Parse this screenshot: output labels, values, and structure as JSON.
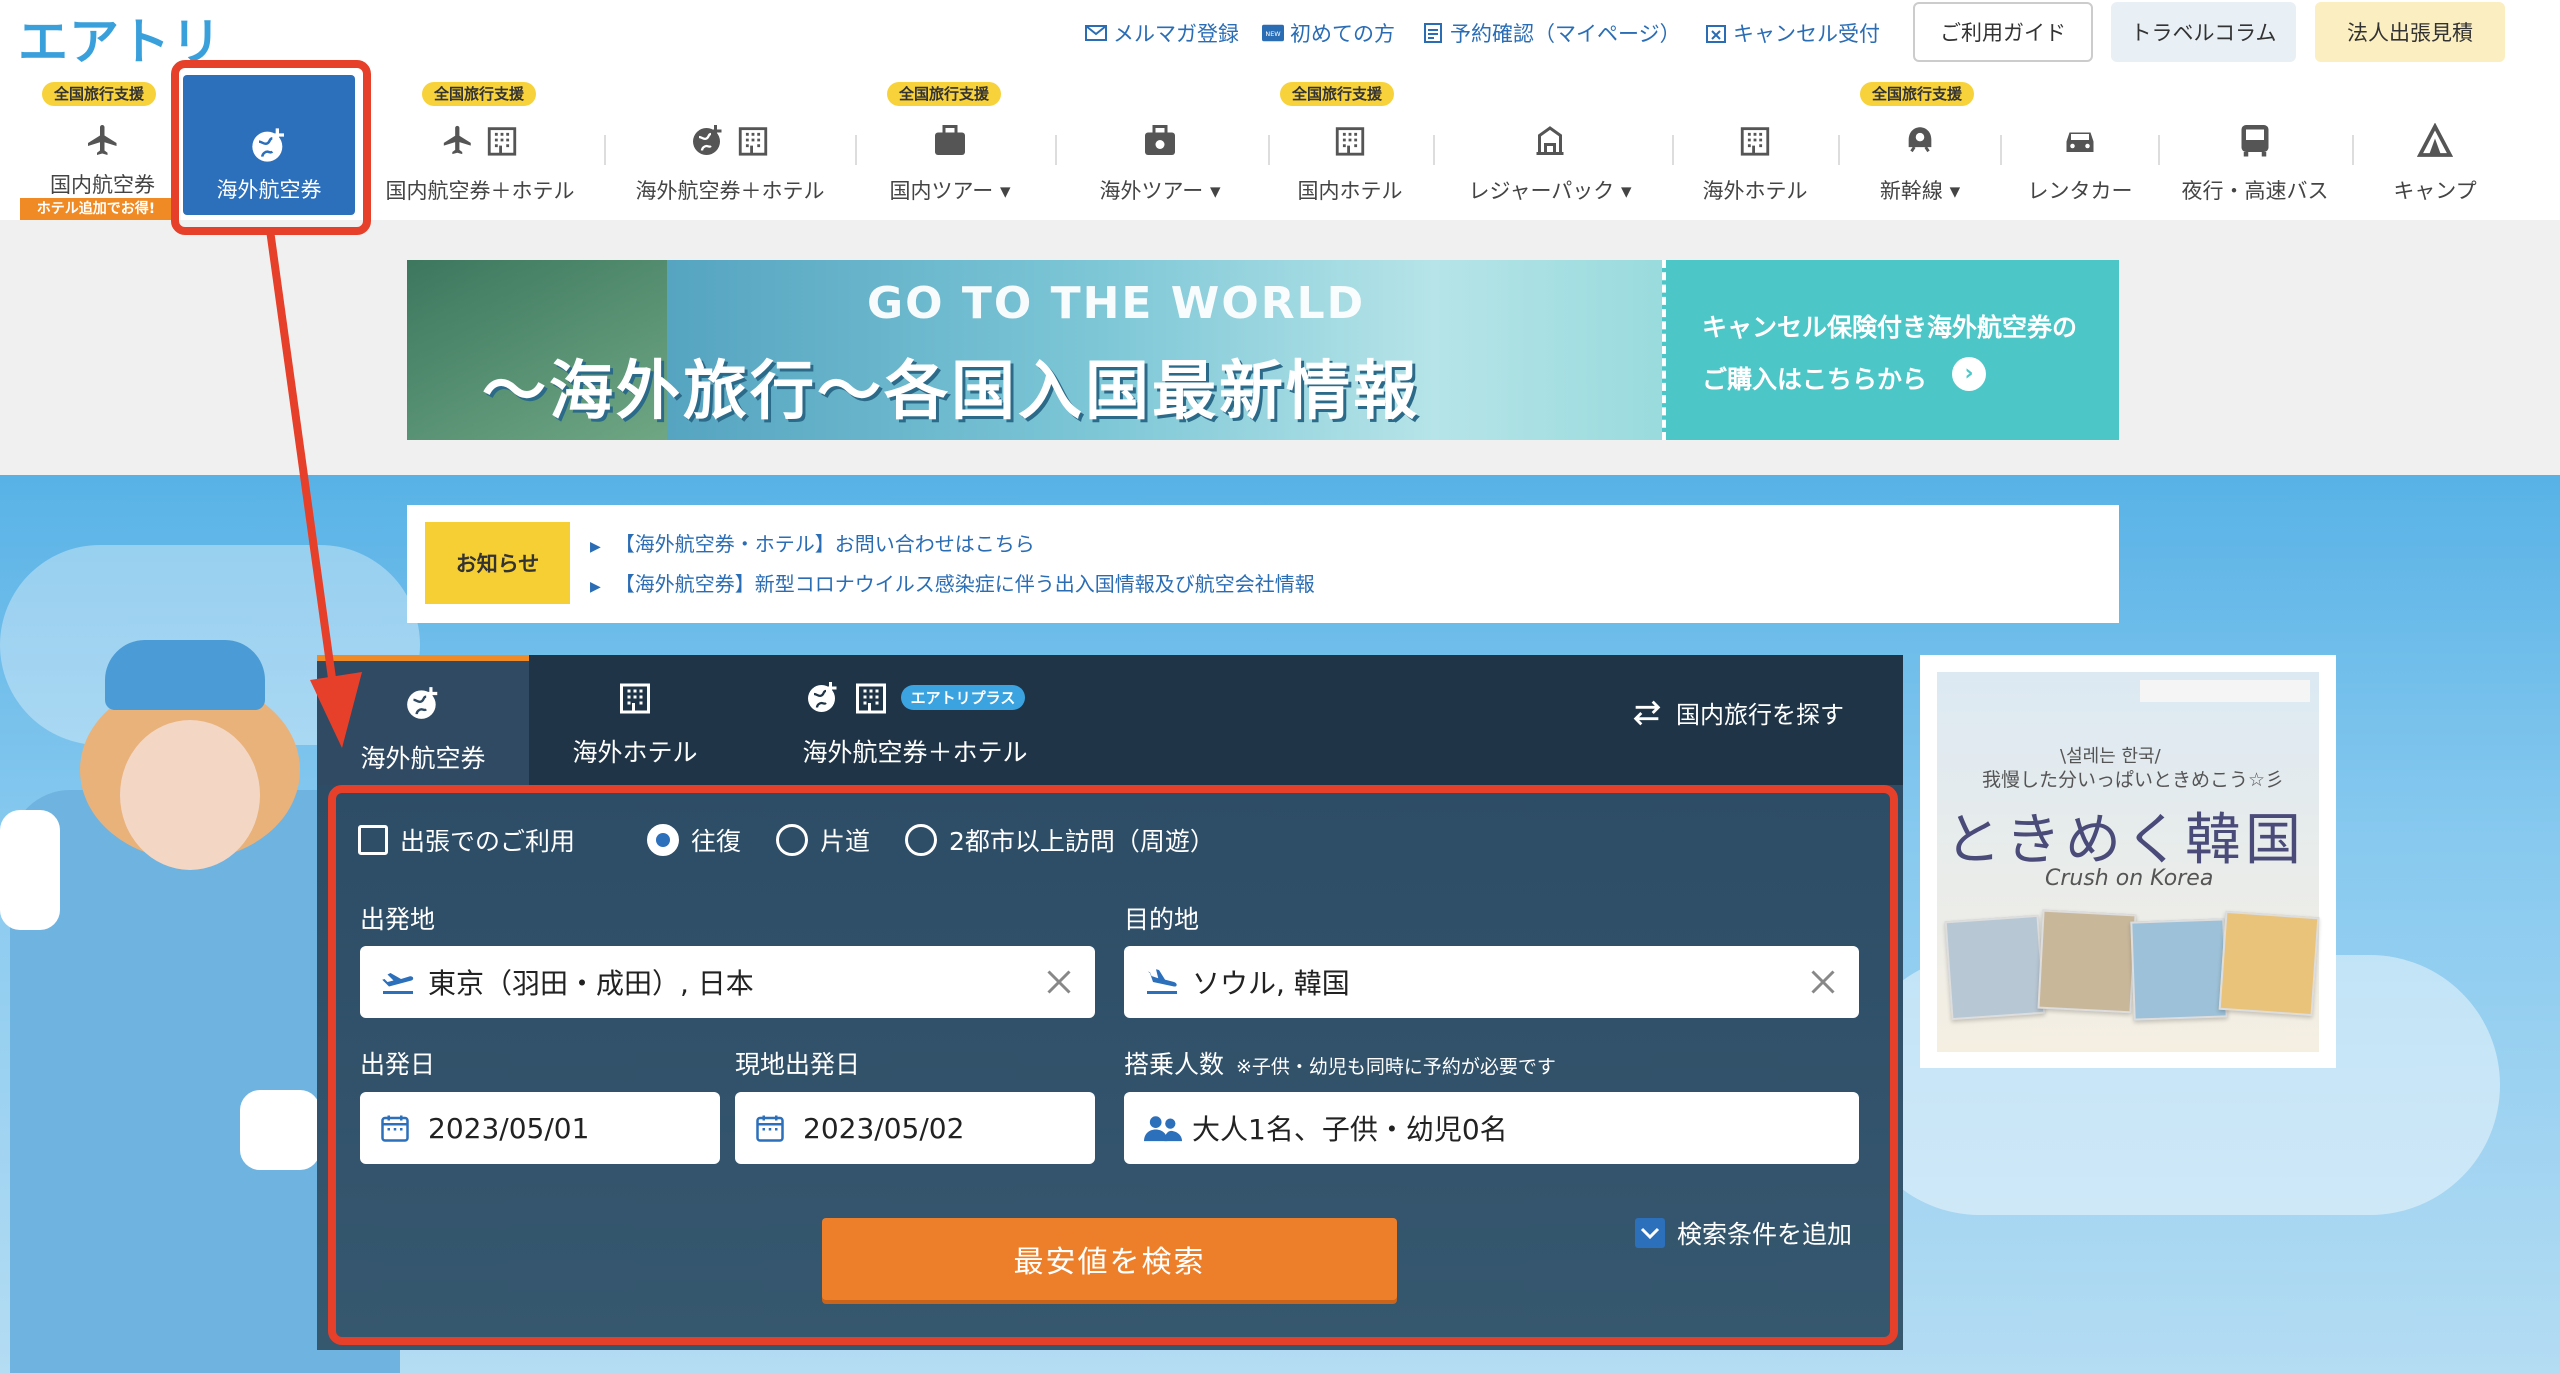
{
  "header": {
    "logo": "エアトリ",
    "links": [
      {
        "label": "メルマガ登録",
        "icon": "mail-icon"
      },
      {
        "label": "初めての方",
        "icon": "new-icon"
      },
      {
        "label": "予約確認（マイページ）",
        "icon": "document-icon"
      },
      {
        "label": "キャンセル受付",
        "icon": "cancel-calendar-icon"
      }
    ],
    "buttons": {
      "guide": "ご利用ガイド",
      "column": "トラベルコラム",
      "corporate": "法人出張見積"
    }
  },
  "nav": {
    "badge": "全国旅行支援",
    "hotel_add": "ホテル追加でお得!",
    "items": [
      {
        "label": "国内航空券",
        "badge": true
      },
      {
        "label": "海外航空券",
        "active": true
      },
      {
        "label": "国内航空券＋ホテル",
        "badge": true
      },
      {
        "label": "海外航空券＋ホテル"
      },
      {
        "label": "国内ツアー",
        "badge": true,
        "dropdown": true
      },
      {
        "label": "海外ツアー",
        "dropdown": true
      },
      {
        "label": "国内ホテル",
        "badge": true
      },
      {
        "label": "レジャーパック",
        "dropdown": true
      },
      {
        "label": "海外ホテル"
      },
      {
        "label": "新幹線",
        "badge": true,
        "dropdown": true
      },
      {
        "label": "レンタカー"
      },
      {
        "label": "夜行・高速バス"
      },
      {
        "label": "キャンプ"
      }
    ]
  },
  "banner": {
    "subtitle": "GO TO THE WORLD",
    "title": "〜海外旅行〜各国入国最新情報",
    "side_line1": "キャンセル保険付き海外航空券の",
    "side_line2": "ご購入はこちらから"
  },
  "notice": {
    "tag": "お知らせ",
    "links": [
      "【海外航空券・ホテル】お問い合わせはこちら",
      "【海外航空券】新型コロナウイルス感染症に伴う出入国情報及び航空会社情報"
    ]
  },
  "search": {
    "tabs": [
      {
        "label": "海外航空券",
        "active": true
      },
      {
        "label": "海外ホテル"
      },
      {
        "label": "海外航空券＋ホテル",
        "badge": "エアトリプラス"
      }
    ],
    "switch_label": "国内旅行を探す",
    "options": {
      "business": "出張でのご利用",
      "round": "往復",
      "oneway": "片道",
      "multi": "2都市以上訪問（周遊）"
    },
    "departure_label": "出発地",
    "departure_value": "東京（羽田・成田）, 日本",
    "destination_label": "目的地",
    "destination_value": "ソウル, 韓国",
    "depart_date_label": "出発日",
    "depart_date_value": "2023/05/01",
    "return_date_label": "現地出発日",
    "return_date_value": "2023/05/02",
    "passengers_label": "搭乗人数",
    "passengers_note": "※子供・幼児も同時に予約が必要です",
    "passengers_value": "大人1名、子供・幼児0名",
    "search_button": "最安値を検索",
    "add_conditions": "検索条件を追加"
  },
  "ad": {
    "korean": "\\설레는 한국/",
    "japanese": "我慢した分いっぱいときめこう☆彡",
    "title": "ときめく韓国",
    "crush": "Crush on Korea"
  },
  "colors": {
    "accent_blue": "#2c6fbb",
    "highlight_red": "#e6402a",
    "search_orange": "#ee7f2a",
    "badge_yellow": "#f7d23b"
  }
}
